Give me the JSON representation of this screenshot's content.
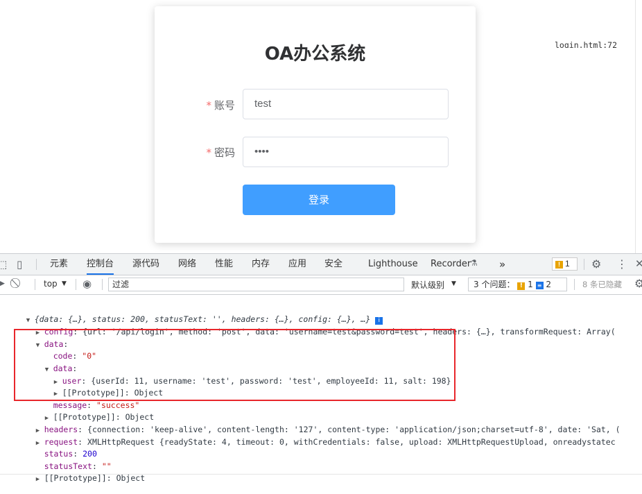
{
  "login": {
    "title": "OA办公系统",
    "username_label": "账号",
    "password_label": "密码",
    "required_mark": "*",
    "username_value": "test",
    "password_value": "••••",
    "submit_label": "登录"
  },
  "devtools": {
    "tabs": [
      "元素",
      "控制台",
      "源代码",
      "网络",
      "性能",
      "内存",
      "应用",
      "安全",
      "Lighthouse",
      "Recorder"
    ],
    "active_tab": "控制台",
    "more_tabs": "»",
    "warn_count": "1",
    "context": "top",
    "filter_placeholder": "过滤",
    "level": "默认级别",
    "issues_label": "3 个问题：",
    "issues_warn": "1",
    "issues_info": "2",
    "hidden_label": "8 条已隐藏",
    "source_link": "login.html:72"
  },
  "console": {
    "summary": "{data: {…}, status: 200, statusText: '', headers: {…}, config: {…}, …}",
    "config_key": "config",
    "config_val": "{url: '/api/login', method: 'post', data: 'username=test&password=test', headers: {…}, transformRequest: Array(",
    "data_key": "data",
    "code_key": "code",
    "code_val": "\"0\"",
    "inner_data_key": "data",
    "user_key": "user",
    "user_val": "{userId: 11, username: 'test', password: 'test', employeeId: 11, salt: 198}",
    "proto_label": "[[Prototype]]",
    "proto_val": "Object",
    "message_key": "message",
    "message_val": "\"success\"",
    "headers_key": "headers",
    "headers_val": "{connection: 'keep-alive', content-length: '127', content-type: 'application/json;charset=utf-8', date: 'Sat, (",
    "request_key": "request",
    "request_val": "XMLHttpRequest {readyState: 4, timeout: 0, withCredentials: false, upload: XMLHttpRequestUpload, onreadystatec",
    "status_key": "status",
    "status_val": "200",
    "statustext_key": "statusText",
    "statustext_val": "\"\""
  },
  "colors": {
    "primary": "#409eff",
    "required": "#f56c6c",
    "highlight_box": "#e8262b",
    "devtools_accent": "#1a73e8"
  }
}
